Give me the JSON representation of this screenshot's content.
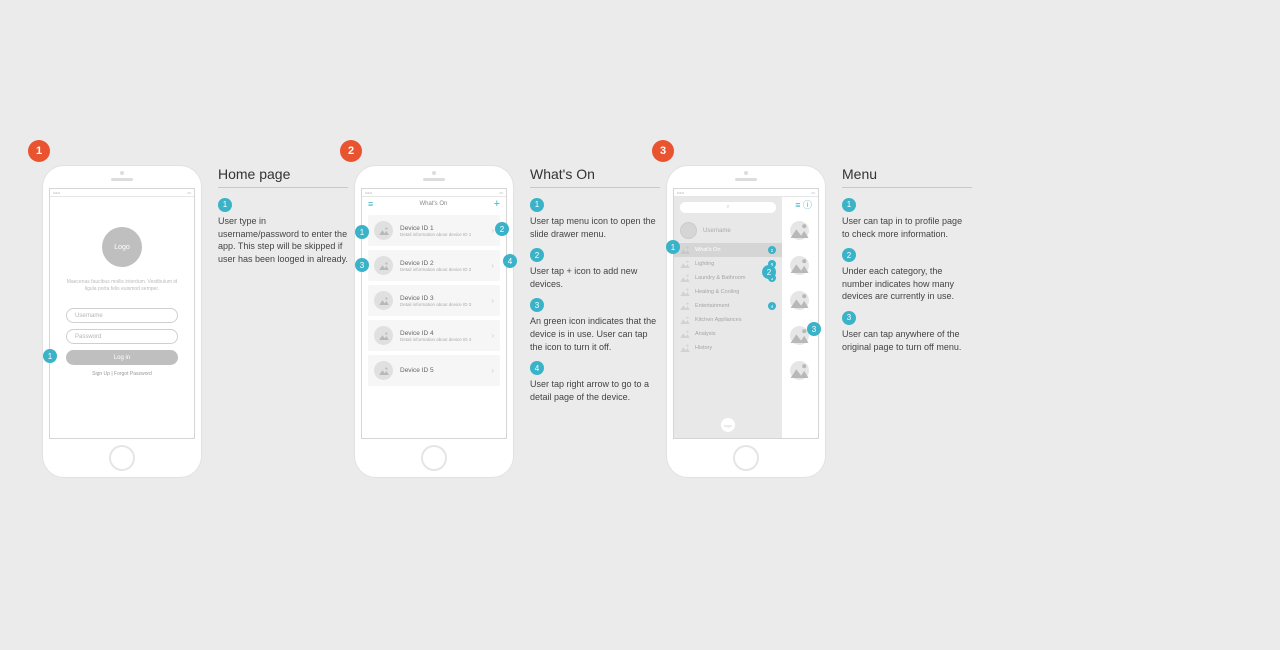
{
  "sections": [
    {
      "num": "1",
      "title": "Home page"
    },
    {
      "num": "2",
      "title": "What's On"
    },
    {
      "num": "3",
      "title": "Menu"
    }
  ],
  "home": {
    "logo": "Logo",
    "lorem": "Maecenas faucibus mollis interdum. Vestibulum id ligula porta felis euismod semper.",
    "username_ph": "Username",
    "password_ph": "Password",
    "login": "Log in",
    "links": "Sign Up | Forgot Password",
    "notes": [
      "User type in username/password to enter the app. This step will be skipped if user has been looged in already."
    ]
  },
  "whatson": {
    "title": "What's On",
    "devices": [
      {
        "title": "Device ID 1",
        "sub": "Detail information about device ID 1"
      },
      {
        "title": "Device ID 2",
        "sub": "Detail information about device ID 2"
      },
      {
        "title": "Device ID 3",
        "sub": "Detail information about device ID 3"
      },
      {
        "title": "Device ID 4",
        "sub": "Detail information about device ID 4"
      },
      {
        "title": "Device ID 5",
        "sub": ""
      }
    ],
    "notes": [
      "User tap menu icon to open the slide drawer menu.",
      "User tap + icon to add new devices.",
      "An green icon indicates that the device is in use. User can tap the icon to turn it off.",
      "User tap right arrow to go to a detail page of the device."
    ]
  },
  "menu": {
    "username": "Username",
    "search_glyph": "⌕",
    "logo_text": "logo",
    "items": [
      {
        "label": "What's On",
        "count": "2"
      },
      {
        "label": "Lighting",
        "count": "8"
      },
      {
        "label": "Laundry & Bathroom",
        "count": "6"
      },
      {
        "label": "Heating & Cooling",
        "count": ""
      },
      {
        "label": "Entertainment",
        "count": "4"
      },
      {
        "label": "Kitchen Appliances",
        "count": ""
      },
      {
        "label": "Analysis",
        "count": ""
      },
      {
        "label": "History",
        "count": ""
      }
    ],
    "behind_header": "≡ ⓘ",
    "notes": [
      "User can tap in to profile page to check more information.",
      "Under each category, the number indicates how many devices are currently in use.",
      "User can tap anywhere of the original page to turn off menu."
    ]
  }
}
